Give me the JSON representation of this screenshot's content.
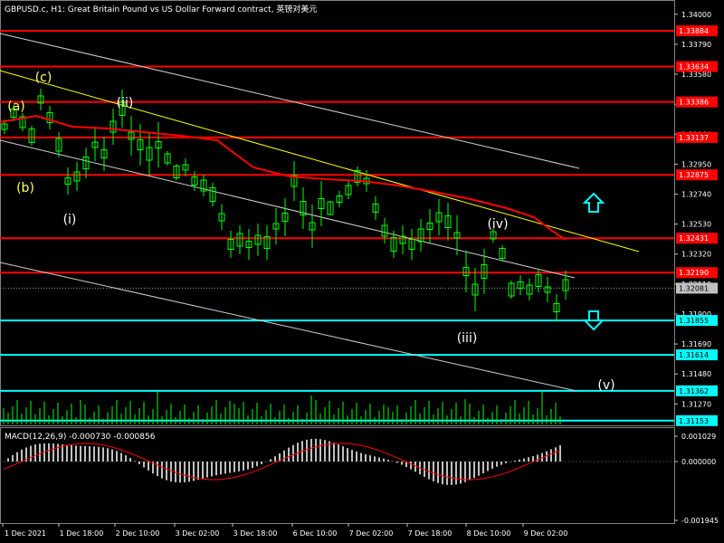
{
  "window": {
    "title": "GBPUSD.c, H1:  Great Britain Pound vs US Dollar Forward contract, 英镑对美元"
  },
  "colors": {
    "background": "#000000",
    "candle": "#00ff00",
    "level_red": "#ff0000",
    "level_cyan": "#00ffff",
    "ma_line": "#ff0000",
    "channel_line": "#ffffff",
    "trend_yellow": "#ffff00",
    "volume_bar": "#00ff00",
    "macd_hist": "#c0c0c0",
    "macd_signal": "#ff0000"
  },
  "price_axis": {
    "ticks": [
      "1.34000",
      "1.33790",
      "1.33580",
      "1.33370",
      "1.33160",
      "1.32950",
      "1.32740",
      "1.32530",
      "1.32320",
      "1.32110",
      "1.31900",
      "1.31690",
      "1.31480",
      "1.31270"
    ]
  },
  "price_labels": [
    {
      "text": "1.33884",
      "kind": "red"
    },
    {
      "text": "1.33634",
      "kind": "red"
    },
    {
      "text": "1.33386",
      "kind": "red"
    },
    {
      "text": "1.33137",
      "kind": "red"
    },
    {
      "text": "1.32875",
      "kind": "red"
    },
    {
      "text": "1.32431",
      "kind": "red"
    },
    {
      "text": "1.32190",
      "kind": "red"
    },
    {
      "text": "1.32081",
      "kind": "current"
    },
    {
      "text": "1.31855",
      "kind": "cyan"
    },
    {
      "text": "1.31614",
      "kind": "cyan"
    },
    {
      "text": "1.31362",
      "kind": "cyan"
    },
    {
      "text": "1.31153",
      "kind": "cyan"
    }
  ],
  "wave_labels": [
    {
      "text": "(a)",
      "color": "#ffff66"
    },
    {
      "text": "(b)",
      "color": "#ffff66"
    },
    {
      "text": "(c)",
      "color": "#ffff66"
    },
    {
      "text": "(i)",
      "color": "#ffffff"
    },
    {
      "text": "(ii)",
      "color": "#ffffff"
    },
    {
      "text": "(iii)",
      "color": "#ffffff"
    },
    {
      "text": "(iv)",
      "color": "#ffffff"
    },
    {
      "text": "(v)",
      "color": "#ffffff"
    }
  ],
  "arrows": [
    {
      "name": "up-arrow-icon",
      "direction": "up"
    },
    {
      "name": "down-arrow-icon",
      "direction": "down"
    }
  ],
  "macd": {
    "title": "MACD(12,26,9) -0.000730 -0.000856",
    "ticks": [
      "0.001029",
      "0.000000",
      "-0.001945"
    ]
  },
  "time_axis": {
    "labels": [
      "1 Dec 2021",
      "1 Dec 18:00",
      "2 Dec 10:00",
      "3 Dec 02:00",
      "3 Dec 18:00",
      "6 Dec 10:00",
      "7 Dec 02:00",
      "7 Dec 18:00",
      "8 Dec 10:00",
      "9 Dec 02:00"
    ]
  }
}
